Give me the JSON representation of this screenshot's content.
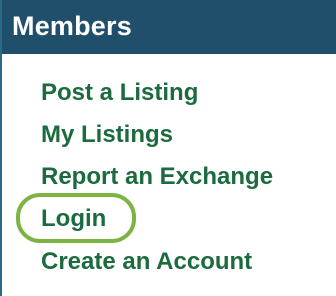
{
  "panel": {
    "title": "Members",
    "items": [
      {
        "label": "Post a Listing"
      },
      {
        "label": "My Listings"
      },
      {
        "label": "Report an Exchange"
      },
      {
        "label": "Login"
      },
      {
        "label": "Create an Account"
      }
    ]
  },
  "colors": {
    "header_bg": "#1f4f6b",
    "link_text": "#1c6b3e",
    "highlight": "#7cb342",
    "border": "#2a6a86"
  }
}
